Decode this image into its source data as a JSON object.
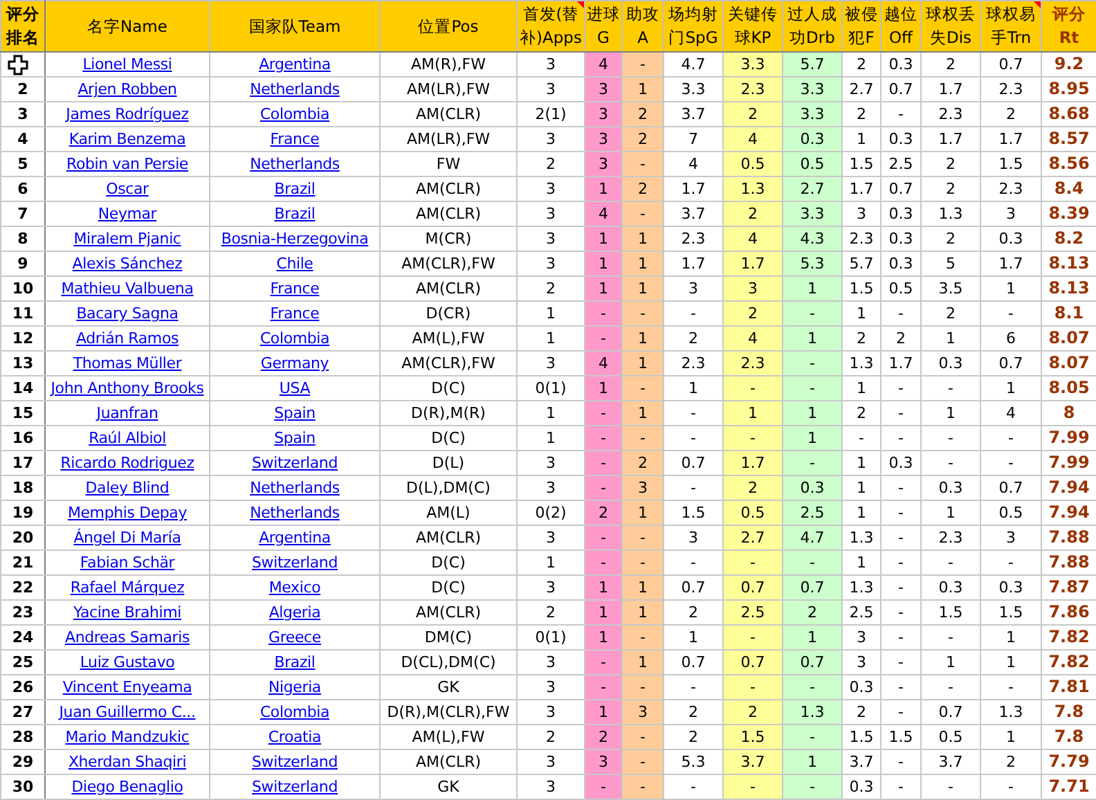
{
  "table": {
    "columns": [
      {
        "lines": [
          "评分",
          "排名"
        ],
        "kind": "rank"
      },
      {
        "lines": [
          "名字Name"
        ],
        "kind": "name"
      },
      {
        "lines": [
          "国家队Team"
        ],
        "kind": "team"
      },
      {
        "lines": [
          "位置Pos"
        ],
        "kind": "text"
      },
      {
        "lines": [
          "首发(替",
          "补)Apps"
        ],
        "kind": "text",
        "comment": true
      },
      {
        "lines": [
          "进球",
          "G"
        ],
        "kind": "text",
        "color": "#ff99cc"
      },
      {
        "lines": [
          "助攻",
          "A"
        ],
        "kind": "text",
        "color": "#ffcc99"
      },
      {
        "lines": [
          "场均射",
          "门SpG"
        ],
        "kind": "text"
      },
      {
        "lines": [
          "关键传",
          "球KP"
        ],
        "kind": "text",
        "color": "#ffff99"
      },
      {
        "lines": [
          "过人成",
          "功Drb"
        ],
        "kind": "text",
        "color": "#ccffcc"
      },
      {
        "lines": [
          "被侵",
          "犯F"
        ],
        "kind": "text"
      },
      {
        "lines": [
          "越位",
          "Off"
        ],
        "kind": "text"
      },
      {
        "lines": [
          "球权丢",
          "失Dis"
        ],
        "kind": "text"
      },
      {
        "lines": [
          "球权易",
          "手Trn"
        ],
        "kind": "text",
        "comment": true
      },
      {
        "lines": [
          "评分",
          "Rt"
        ],
        "kind": "rating"
      }
    ],
    "rows": [
      {
        "pointer": true,
        "cells": [
          "",
          "Lionel Messi",
          "Argentina",
          "AM(R),FW",
          "3",
          "4",
          "-",
          "4.7",
          "3.3",
          "5.7",
          "2",
          "0.3",
          "2",
          "0.7",
          "9.2"
        ]
      },
      {
        "cells": [
          "2",
          "Arjen Robben",
          "Netherlands",
          "AM(LR),FW",
          "3",
          "3",
          "1",
          "3.3",
          "2.3",
          "3.3",
          "2.7",
          "0.7",
          "1.7",
          "2.3",
          "8.95"
        ]
      },
      {
        "cells": [
          "3",
          "James Rodríguez",
          "Colombia",
          "AM(CLR)",
          "2(1)",
          "3",
          "2",
          "3.7",
          "2",
          "3.3",
          "2",
          "-",
          "2.3",
          "2",
          "8.68"
        ]
      },
      {
        "cells": [
          "4",
          "Karim Benzema",
          "France",
          "AM(LR),FW",
          "3",
          "3",
          "2",
          "7",
          "4",
          "0.3",
          "1",
          "0.3",
          "1.7",
          "1.7",
          "8.57"
        ]
      },
      {
        "cells": [
          "5",
          "Robin van Persie",
          "Netherlands",
          "FW",
          "2",
          "3",
          "-",
          "4",
          "0.5",
          "0.5",
          "1.5",
          "2.5",
          "2",
          "1.5",
          "8.56"
        ]
      },
      {
        "cells": [
          "6",
          "Oscar",
          "Brazil",
          "AM(CLR)",
          "3",
          "1",
          "2",
          "1.7",
          "1.3",
          "2.7",
          "1.7",
          "0.7",
          "2",
          "2.3",
          "8.4"
        ]
      },
      {
        "cells": [
          "7",
          "Neymar",
          "Brazil",
          "AM(CLR)",
          "3",
          "4",
          "-",
          "3.7",
          "2",
          "3.3",
          "3",
          "0.3",
          "1.3",
          "3",
          "8.39"
        ]
      },
      {
        "cells": [
          "8",
          "Miralem Pjanic",
          "Bosnia-Herzegovina",
          "M(CR)",
          "3",
          "1",
          "1",
          "2.3",
          "4",
          "4.3",
          "2.3",
          "0.3",
          "2",
          "0.3",
          "8.2"
        ]
      },
      {
        "cells": [
          "9",
          "Alexis Sánchez",
          "Chile",
          "AM(CLR),FW",
          "3",
          "1",
          "1",
          "1.7",
          "1.7",
          "5.3",
          "5.7",
          "0.3",
          "5",
          "1.7",
          "8.13"
        ]
      },
      {
        "cells": [
          "10",
          "Mathieu Valbuena",
          "France",
          "AM(CLR)",
          "2",
          "1",
          "1",
          "3",
          "3",
          "1",
          "1.5",
          "0.5",
          "3.5",
          "1",
          "8.13"
        ]
      },
      {
        "cells": [
          "11",
          "Bacary Sagna",
          "France",
          "D(CR)",
          "1",
          "-",
          "-",
          "-",
          "2",
          "-",
          "1",
          "-",
          "2",
          "-",
          "8.1"
        ]
      },
      {
        "cells": [
          "12",
          "Adrián Ramos",
          "Colombia",
          "AM(L),FW",
          "1",
          "-",
          "1",
          "2",
          "4",
          "1",
          "2",
          "2",
          "1",
          "6",
          "8.07"
        ]
      },
      {
        "cells": [
          "13",
          "Thomas Müller",
          "Germany",
          "AM(CLR),FW",
          "3",
          "4",
          "1",
          "2.3",
          "2.3",
          "-",
          "1.3",
          "1.7",
          "0.3",
          "0.7",
          "8.07"
        ]
      },
      {
        "cells": [
          "14",
          "John Anthony Brooks",
          "USA",
          "D(C)",
          "0(1)",
          "1",
          "-",
          "1",
          "-",
          "-",
          "1",
          "-",
          "-",
          "1",
          "8.05"
        ]
      },
      {
        "cells": [
          "15",
          "Juanfran",
          "Spain",
          "D(R),M(R)",
          "1",
          "-",
          "1",
          "-",
          "1",
          "1",
          "2",
          "-",
          "1",
          "4",
          "8"
        ]
      },
      {
        "cells": [
          "16",
          "Raúl Albiol",
          "Spain",
          "D(C)",
          "1",
          "-",
          "-",
          "-",
          "-",
          "1",
          "-",
          "-",
          "-",
          "-",
          "7.99"
        ]
      },
      {
        "cells": [
          "17",
          "Ricardo Rodriguez",
          "Switzerland",
          "D(L)",
          "3",
          "-",
          "2",
          "0.7",
          "1.7",
          "-",
          "1",
          "0.3",
          "-",
          "-",
          "7.99"
        ]
      },
      {
        "cells": [
          "18",
          "Daley Blind",
          "Netherlands",
          "D(L),DM(C)",
          "3",
          "-",
          "3",
          "-",
          "2",
          "0.3",
          "1",
          "-",
          "0.3",
          "0.7",
          "7.94"
        ]
      },
      {
        "cells": [
          "19",
          "Memphis Depay",
          "Netherlands",
          "AM(L)",
          "0(2)",
          "2",
          "1",
          "1.5",
          "0.5",
          "2.5",
          "1",
          "-",
          "1",
          "0.5",
          "7.94"
        ]
      },
      {
        "cells": [
          "20",
          "Ángel Di María",
          "Argentina",
          "AM(CLR)",
          "3",
          "-",
          "-",
          "3",
          "2.7",
          "4.7",
          "1.3",
          "-",
          "2.3",
          "3",
          "7.88"
        ]
      },
      {
        "cells": [
          "21",
          "Fabian Schär",
          "Switzerland",
          "D(C)",
          "1",
          "-",
          "-",
          "-",
          "-",
          "-",
          "1",
          "-",
          "-",
          "-",
          "7.88"
        ]
      },
      {
        "cells": [
          "22",
          "Rafael Márquez",
          "Mexico",
          "D(C)",
          "3",
          "1",
          "1",
          "0.7",
          "0.7",
          "0.7",
          "1.3",
          "-",
          "0.3",
          "0.3",
          "7.87"
        ]
      },
      {
        "cells": [
          "23",
          "Yacine Brahimi",
          "Algeria",
          "AM(CLR)",
          "2",
          "1",
          "1",
          "2",
          "2.5",
          "2",
          "2.5",
          "-",
          "1.5",
          "1.5",
          "7.86"
        ]
      },
      {
        "cells": [
          "24",
          "Andreas Samaris",
          "Greece",
          "DM(C)",
          "0(1)",
          "1",
          "-",
          "1",
          "-",
          "1",
          "3",
          "-",
          "-",
          "1",
          "7.82"
        ]
      },
      {
        "cells": [
          "25",
          "Luiz Gustavo",
          "Brazil",
          "D(CL),DM(C)",
          "3",
          "-",
          "1",
          "0.7",
          "0.7",
          "0.7",
          "3",
          "-",
          "1",
          "1",
          "7.82"
        ]
      },
      {
        "cells": [
          "26",
          "Vincent Enyeama",
          "Nigeria",
          "GK",
          "3",
          "-",
          "-",
          "-",
          "-",
          "-",
          "0.3",
          "-",
          "-",
          "-",
          "7.81"
        ]
      },
      {
        "cells": [
          "27",
          "Juan Guillermo C...",
          "Colombia",
          "D(R),M(CLR),FW",
          "3",
          "1",
          "3",
          "2",
          "2",
          "1.3",
          "2",
          "-",
          "0.7",
          "1.3",
          "7.8"
        ]
      },
      {
        "cells": [
          "28",
          "Mario Mandzukic",
          "Croatia",
          "AM(L),FW",
          "2",
          "2",
          "-",
          "2",
          "1.5",
          "-",
          "1.5",
          "1.5",
          "0.5",
          "1",
          "7.8"
        ]
      },
      {
        "cells": [
          "29",
          "Xherdan Shaqiri",
          "Switzerland",
          "AM(CLR)",
          "3",
          "3",
          "-",
          "5.3",
          "3.7",
          "1",
          "3.7",
          "-",
          "3.7",
          "2",
          "7.79"
        ]
      },
      {
        "cells": [
          "30",
          "Diego Benaglio",
          "Switzerland",
          "GK",
          "3",
          "-",
          "-",
          "-",
          "-",
          "-",
          "0.3",
          "-",
          "-",
          "-",
          "7.71"
        ]
      }
    ]
  }
}
